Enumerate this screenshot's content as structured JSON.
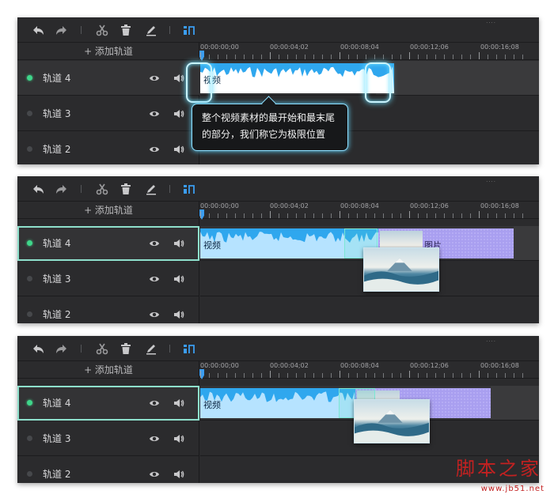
{
  "toolbar": {
    "icons": [
      "undo-icon",
      "redo-icon",
      "cut-icon",
      "delete-icon",
      "edit-icon",
      "snap-icon"
    ],
    "grip": "...."
  },
  "tracks_panel": {
    "add_track": "+ 添加轨道",
    "tracks": [
      {
        "name": "轨道 4",
        "active": true
      },
      {
        "name": "轨道 3",
        "active": false
      },
      {
        "name": "轨道 2",
        "active": false
      }
    ]
  },
  "ruler": {
    "labels": [
      "00:00:00;00",
      "00:00:04;02",
      "00:00:08;04",
      "00:00:12;06",
      "00:00:16;08"
    ]
  },
  "clips": {
    "video_label": "视频",
    "image_label": "图片"
  },
  "tooltip": {
    "line1": "整个视频素材的最开始和最末尾",
    "line2": "的部分，我们称它为极限位置"
  },
  "watermark": {
    "text": "脚本之家",
    "url": "www.jb51.net"
  },
  "colors": {
    "accent": "#2fa7ee",
    "image_clip": "#a99ff0",
    "selection": "#8ee0cc",
    "active_dot": "#3fd68a",
    "watermark": "#c32121"
  }
}
